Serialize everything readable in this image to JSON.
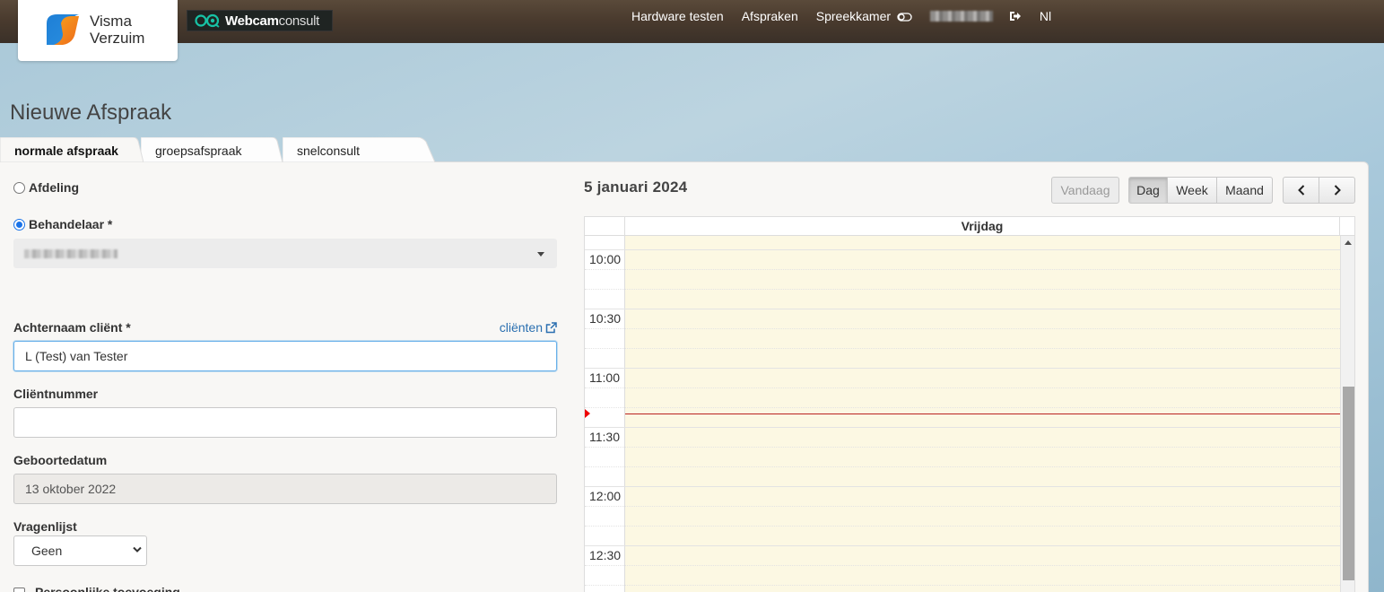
{
  "header": {
    "logo_line1": "Visma",
    "logo_line2": "Verzuim",
    "webcam_brand_bold": "Webcam",
    "webcam_brand_light": "consult",
    "nav": {
      "hardware": "Hardware testen",
      "afspraken": "Afspraken",
      "spreekkamer": "Spreekkamer",
      "language": "Nl"
    },
    "icons": [
      "logo-icon",
      "webcam-icon",
      "toggle-icon",
      "logout-icon"
    ]
  },
  "page": {
    "title": "Nieuwe Afspraak",
    "tabs": [
      "normale afspraak",
      "groepsafspraak",
      "snelconsult"
    ]
  },
  "form": {
    "afdeling_label": "Afdeling",
    "behandelaar_label": "Behandelaar *",
    "achternaam_label": "Achternaam cliënt *",
    "clienten_link": "cliënten",
    "achternaam_value": "L (Test) van Tester",
    "clientnummer_label": "Cliëntnummer",
    "clientnummer_value": "",
    "geboortedatum_label": "Geboortedatum",
    "geboortedatum_value": "13 oktober 2022",
    "vragenlijst_label": "Vragenlijst",
    "vragenlijst_value": "Geen",
    "checkbox_label": "Persoonlijke toevoeging"
  },
  "calendar": {
    "date": "5 januari 2024",
    "buttons": {
      "vandaag": "Vandaag",
      "dag": "Dag",
      "week": "Week",
      "maand": "Maand"
    },
    "day_header": "Vrijdag",
    "times": [
      "10:00",
      "10:30",
      "11:00",
      "11:30",
      "12:00",
      "12:30"
    ],
    "colors": {
      "slot_bg": "#fcf8e3",
      "now_line": "#b22222",
      "link": "#2a6fb0"
    }
  }
}
